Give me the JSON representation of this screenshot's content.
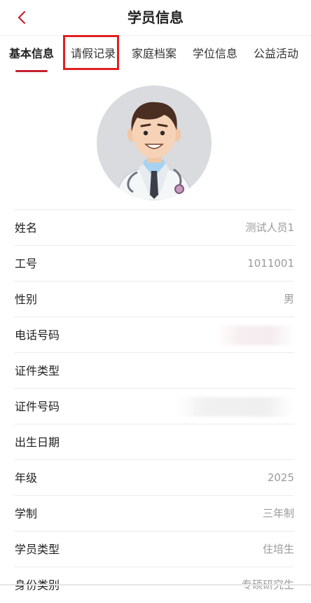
{
  "header": {
    "title": "学员信息",
    "back_icon": "chevron-left-icon"
  },
  "tabs": [
    {
      "label": "基本信息",
      "active": true
    },
    {
      "label": "请假记录",
      "highlighted": true
    },
    {
      "label": "家庭档案"
    },
    {
      "label": "学位信息"
    },
    {
      "label": "公益活动"
    }
  ],
  "profile": {
    "avatar_icon": "doctor-avatar-icon"
  },
  "fields": [
    {
      "label": "姓名",
      "value": "测试人员1"
    },
    {
      "label": "工号",
      "value": "1011001"
    },
    {
      "label": "性别",
      "value": "男"
    },
    {
      "label": "电话号码",
      "value": ""
    },
    {
      "label": "证件类型",
      "value": ""
    },
    {
      "label": "证件号码",
      "value": ""
    },
    {
      "label": "出生日期",
      "value": ""
    },
    {
      "label": "年级",
      "value": "2025"
    },
    {
      "label": "学制",
      "value": "三年制"
    },
    {
      "label": "学员类型",
      "value": "住培生"
    },
    {
      "label": "身份类别",
      "value": "专硕研究生"
    }
  ],
  "colors": {
    "accent": "#c4212f",
    "highlight": "#e02020",
    "value_text": "#9a9a9a"
  }
}
